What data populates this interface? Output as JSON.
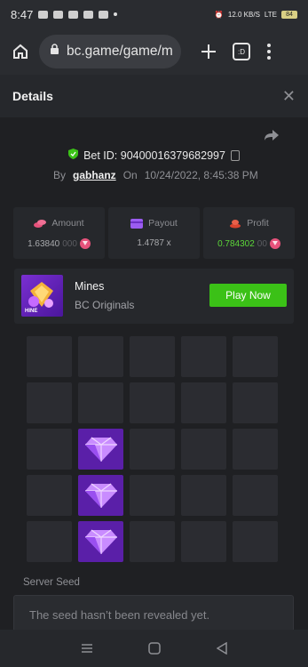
{
  "status": {
    "time": "8:47",
    "speed": "12.0 KB/S",
    "signal": "LTE",
    "battery": "84"
  },
  "browser": {
    "url": "bc.game/game/m",
    "tabs_count": ":D"
  },
  "header": {
    "title": "Details"
  },
  "bet": {
    "id_label": "Bet ID: 90400016379682997",
    "by_label": "By",
    "username": "gabhanz",
    "on_label": "On",
    "datetime": "10/24/2022, 8:45:38 PM"
  },
  "stats": {
    "amount": {
      "label": "Amount",
      "value_main": "1.63840",
      "value_dim": "000"
    },
    "payout": {
      "label": "Payout",
      "value": "1.4787 x"
    },
    "profit": {
      "label": "Profit",
      "value_main": "0.784302",
      "value_dim": "00"
    }
  },
  "game": {
    "name": "Mines",
    "provider": "BC Originals",
    "play_label": "Play Now",
    "thumb_text": "HINE"
  },
  "grid": {
    "gems": [
      [
        2,
        1
      ],
      [
        3,
        1
      ],
      [
        4,
        1
      ]
    ]
  },
  "seed": {
    "label": "Server Seed",
    "text": "The seed hasn’t been revealed yet."
  },
  "colors": {
    "accent_green": "#3bc117",
    "gem_purple": "#5a1fa8",
    "profit_green": "#5cd639",
    "coin_pink": "#e6527b"
  }
}
